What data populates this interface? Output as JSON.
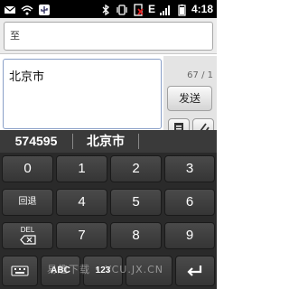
{
  "status_bar": {
    "time": "4:18",
    "icons": [
      "notification-icon",
      "wifi-icon",
      "usb-icon",
      "bluetooth-icon",
      "vibrate-icon",
      "no-sim-icon",
      "edge-network-icon",
      "signal-icon",
      "battery-icon"
    ],
    "edge_label": "E"
  },
  "recipient": {
    "label": "至"
  },
  "compose": {
    "message": "北京市",
    "char_counter": "67 / 1",
    "send_label": "发送"
  },
  "candidates": [
    "574595",
    "北京市"
  ],
  "keyboard": {
    "rows": [
      [
        "0",
        "1",
        "2",
        "3"
      ],
      [
        "回退",
        "4",
        "5",
        "6"
      ],
      [
        "DEL",
        "7",
        "8",
        "9"
      ],
      [
        "",
        "ABC",
        "123",
        ""
      ]
    ]
  },
  "watermark": "易趣下载 • YCU.JX.CN"
}
